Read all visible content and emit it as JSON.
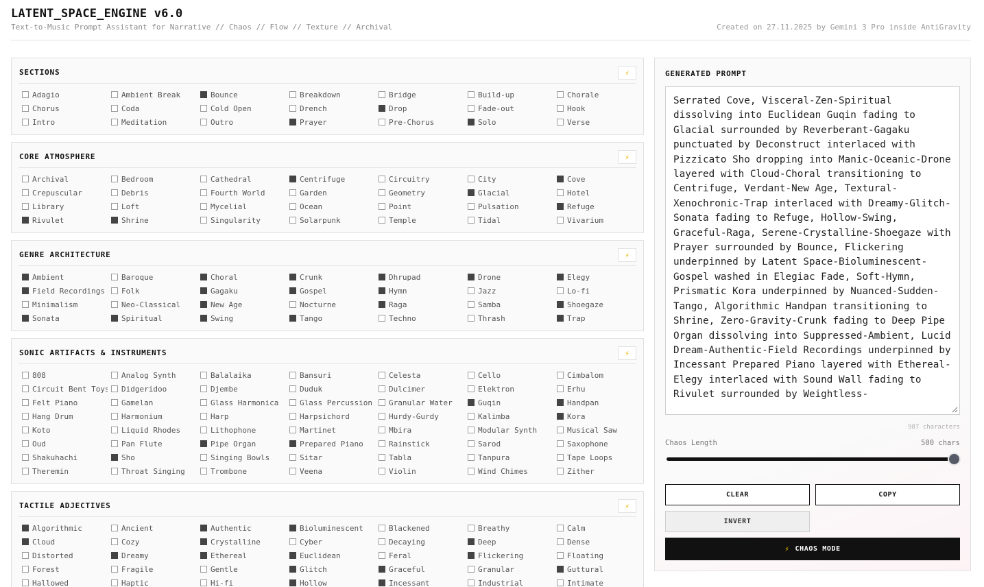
{
  "header": {
    "title": "LATENT_SPACE_ENGINE v6.0",
    "subtitle": "Text-to-Music Prompt Assistant for Narrative // Chaos // Flow // Texture // Archival",
    "credit": "Created on 27.11.2025 by Gemini 3 Pro inside AntiGravity"
  },
  "icons": {
    "randomize": "lightning-bolt-icon",
    "resize": "resize-grip-icon"
  },
  "colors": {
    "checked": "#444444",
    "accent_bolt": "#e6b800",
    "chaos_button": "#111111"
  },
  "sections": [
    {
      "title": "SECTIONS",
      "options": [
        {
          "label": "Adagio",
          "checked": false
        },
        {
          "label": "Ambient Break",
          "checked": false
        },
        {
          "label": "Bounce",
          "checked": true
        },
        {
          "label": "Breakdown",
          "checked": false
        },
        {
          "label": "Bridge",
          "checked": false
        },
        {
          "label": "Build-up",
          "checked": false
        },
        {
          "label": "Chorale",
          "checked": false
        },
        {
          "label": "Chorus",
          "checked": false
        },
        {
          "label": "Coda",
          "checked": false
        },
        {
          "label": "Cold Open",
          "checked": false
        },
        {
          "label": "Drench",
          "checked": false
        },
        {
          "label": "Drop",
          "checked": true
        },
        {
          "label": "Fade-out",
          "checked": false
        },
        {
          "label": "Hook",
          "checked": false
        },
        {
          "label": "Intro",
          "checked": false
        },
        {
          "label": "Meditation",
          "checked": false
        },
        {
          "label": "Outro",
          "checked": false
        },
        {
          "label": "Prayer",
          "checked": true
        },
        {
          "label": "Pre-Chorus",
          "checked": false
        },
        {
          "label": "Solo",
          "checked": true
        },
        {
          "label": "Verse",
          "checked": false
        }
      ]
    },
    {
      "title": "CORE ATMOSPHERE",
      "options": [
        {
          "label": "Archival",
          "checked": false
        },
        {
          "label": "Bedroom",
          "checked": false
        },
        {
          "label": "Cathedral",
          "checked": false
        },
        {
          "label": "Centrifuge",
          "checked": true
        },
        {
          "label": "Circuitry",
          "checked": false
        },
        {
          "label": "City",
          "checked": false
        },
        {
          "label": "Cove",
          "checked": true
        },
        {
          "label": "Crepuscular",
          "checked": false
        },
        {
          "label": "Debris",
          "checked": false
        },
        {
          "label": "Fourth World",
          "checked": false
        },
        {
          "label": "Garden",
          "checked": false
        },
        {
          "label": "Geometry",
          "checked": false
        },
        {
          "label": "Glacial",
          "checked": true
        },
        {
          "label": "Hotel",
          "checked": false
        },
        {
          "label": "Library",
          "checked": false
        },
        {
          "label": "Loft",
          "checked": false
        },
        {
          "label": "Mycelial",
          "checked": false
        },
        {
          "label": "Ocean",
          "checked": false
        },
        {
          "label": "Point",
          "checked": false
        },
        {
          "label": "Pulsation",
          "checked": false
        },
        {
          "label": "Refuge",
          "checked": true
        },
        {
          "label": "Rivulet",
          "checked": true
        },
        {
          "label": "Shrine",
          "checked": true
        },
        {
          "label": "Singularity",
          "checked": false
        },
        {
          "label": "Solarpunk",
          "checked": false
        },
        {
          "label": "Temple",
          "checked": false
        },
        {
          "label": "Tidal",
          "checked": false
        },
        {
          "label": "Vivarium",
          "checked": false
        }
      ]
    },
    {
      "title": "GENRE ARCHITECTURE",
      "options": [
        {
          "label": "Ambient",
          "checked": true
        },
        {
          "label": "Baroque",
          "checked": false
        },
        {
          "label": "Choral",
          "checked": true
        },
        {
          "label": "Crunk",
          "checked": true
        },
        {
          "label": "Dhrupad",
          "checked": true
        },
        {
          "label": "Drone",
          "checked": true
        },
        {
          "label": "Elegy",
          "checked": true
        },
        {
          "label": "Field Recordings",
          "checked": true
        },
        {
          "label": "Folk",
          "checked": false
        },
        {
          "label": "Gagaku",
          "checked": true
        },
        {
          "label": "Gospel",
          "checked": true
        },
        {
          "label": "Hymn",
          "checked": true
        },
        {
          "label": "Jazz",
          "checked": false
        },
        {
          "label": "Lo-fi",
          "checked": false
        },
        {
          "label": "Minimalism",
          "checked": false
        },
        {
          "label": "Neo-Classical",
          "checked": false
        },
        {
          "label": "New Age",
          "checked": true
        },
        {
          "label": "Nocturne",
          "checked": false
        },
        {
          "label": "Raga",
          "checked": true
        },
        {
          "label": "Samba",
          "checked": false
        },
        {
          "label": "Shoegaze",
          "checked": true
        },
        {
          "label": "Sonata",
          "checked": true
        },
        {
          "label": "Spiritual",
          "checked": true
        },
        {
          "label": "Swing",
          "checked": true
        },
        {
          "label": "Tango",
          "checked": true
        },
        {
          "label": "Techno",
          "checked": false
        },
        {
          "label": "Thrash",
          "checked": false
        },
        {
          "label": "Trap",
          "checked": true
        }
      ]
    },
    {
      "title": "SONIC ARTIFACTS & INSTRUMENTS",
      "options": [
        {
          "label": "808",
          "checked": false
        },
        {
          "label": "Analog Synth",
          "checked": false
        },
        {
          "label": "Balalaika",
          "checked": false
        },
        {
          "label": "Bansuri",
          "checked": false
        },
        {
          "label": "Celesta",
          "checked": false
        },
        {
          "label": "Cello",
          "checked": false
        },
        {
          "label": "Cimbalom",
          "checked": false
        },
        {
          "label": "Circuit Bent Toys",
          "checked": false
        },
        {
          "label": "Didgeridoo",
          "checked": false
        },
        {
          "label": "Djembe",
          "checked": false
        },
        {
          "label": "Duduk",
          "checked": false
        },
        {
          "label": "Dulcimer",
          "checked": false
        },
        {
          "label": "Elektron",
          "checked": false
        },
        {
          "label": "Erhu",
          "checked": false
        },
        {
          "label": "Felt Piano",
          "checked": false
        },
        {
          "label": "Gamelan",
          "checked": false
        },
        {
          "label": "Glass Harmonica",
          "checked": false
        },
        {
          "label": "Glass Percussion",
          "checked": false
        },
        {
          "label": "Granular Water",
          "checked": false
        },
        {
          "label": "Guqin",
          "checked": true
        },
        {
          "label": "Handpan",
          "checked": true
        },
        {
          "label": "Hang Drum",
          "checked": false
        },
        {
          "label": "Harmonium",
          "checked": false
        },
        {
          "label": "Harp",
          "checked": false
        },
        {
          "label": "Harpsichord",
          "checked": false
        },
        {
          "label": "Hurdy-Gurdy",
          "checked": false
        },
        {
          "label": "Kalimba",
          "checked": false
        },
        {
          "label": "Kora",
          "checked": true
        },
        {
          "label": "Koto",
          "checked": false
        },
        {
          "label": "Liquid Rhodes",
          "checked": false
        },
        {
          "label": "Lithophone",
          "checked": false
        },
        {
          "label": "Martinet",
          "checked": false
        },
        {
          "label": "Mbira",
          "checked": false
        },
        {
          "label": "Modular Synth",
          "checked": false
        },
        {
          "label": "Musical Saw",
          "checked": false
        },
        {
          "label": "Oud",
          "checked": false
        },
        {
          "label": "Pan Flute",
          "checked": false
        },
        {
          "label": "Pipe Organ",
          "checked": true
        },
        {
          "label": "Prepared Piano",
          "checked": true
        },
        {
          "label": "Rainstick",
          "checked": false
        },
        {
          "label": "Sarod",
          "checked": false
        },
        {
          "label": "Saxophone",
          "checked": false
        },
        {
          "label": "Shakuhachi",
          "checked": false
        },
        {
          "label": "Sho",
          "checked": true
        },
        {
          "label": "Singing Bowls",
          "checked": false
        },
        {
          "label": "Sitar",
          "checked": false
        },
        {
          "label": "Tabla",
          "checked": false
        },
        {
          "label": "Tanpura",
          "checked": false
        },
        {
          "label": "Tape Loops",
          "checked": false
        },
        {
          "label": "Theremin",
          "checked": false
        },
        {
          "label": "Throat Singing",
          "checked": false
        },
        {
          "label": "Trombone",
          "checked": false
        },
        {
          "label": "Veena",
          "checked": false
        },
        {
          "label": "Violin",
          "checked": false
        },
        {
          "label": "Wind Chimes",
          "checked": false
        },
        {
          "label": "Zither",
          "checked": false
        }
      ]
    },
    {
      "title": "TACTILE ADJECTIVES",
      "options": [
        {
          "label": "Algorithmic",
          "checked": true
        },
        {
          "label": "Ancient",
          "checked": false
        },
        {
          "label": "Authentic",
          "checked": true
        },
        {
          "label": "Bioluminescent",
          "checked": true
        },
        {
          "label": "Blackened",
          "checked": false
        },
        {
          "label": "Breathy",
          "checked": false
        },
        {
          "label": "Calm",
          "checked": false
        },
        {
          "label": "Cloud",
          "checked": true
        },
        {
          "label": "Cozy",
          "checked": false
        },
        {
          "label": "Crystalline",
          "checked": true
        },
        {
          "label": "Cyber",
          "checked": false
        },
        {
          "label": "Decaying",
          "checked": false
        },
        {
          "label": "Deep",
          "checked": true
        },
        {
          "label": "Dense",
          "checked": false
        },
        {
          "label": "Distorted",
          "checked": false
        },
        {
          "label": "Dreamy",
          "checked": true
        },
        {
          "label": "Ethereal",
          "checked": true
        },
        {
          "label": "Euclidean",
          "checked": true
        },
        {
          "label": "Feral",
          "checked": false
        },
        {
          "label": "Flickering",
          "checked": true
        },
        {
          "label": "Floating",
          "checked": false
        },
        {
          "label": "Forest",
          "checked": false
        },
        {
          "label": "Fragile",
          "checked": false
        },
        {
          "label": "Gentle",
          "checked": false
        },
        {
          "label": "Glitch",
          "checked": true
        },
        {
          "label": "Graceful",
          "checked": true
        },
        {
          "label": "Granular",
          "checked": false
        },
        {
          "label": "Guttural",
          "checked": true
        },
        {
          "label": "Hallowed",
          "checked": false
        },
        {
          "label": "Haptic",
          "checked": false
        },
        {
          "label": "Hi-fi",
          "checked": false
        },
        {
          "label": "Hollow",
          "checked": true
        },
        {
          "label": "Incessant",
          "checked": true
        },
        {
          "label": "Industrial",
          "checked": false
        },
        {
          "label": "Intimate",
          "checked": false
        }
      ]
    }
  ],
  "output": {
    "title": "GENERATED PROMPT",
    "prompt_text": "Serrated Cove, Visceral-Zen-Spiritual dissolving into Euclidean Guqin fading to Glacial surrounded by Reverberant-Gagaku punctuated by Deconstruct interlaced with Pizzicato Sho dropping into Manic-Oceanic-Drone layered with Cloud-Choral transitioning to Centrifuge, Verdant-New Age, Textural-Xenochronic-Trap interlaced with Dreamy-Glitch-Sonata fading to Refuge, Hollow-Swing, Graceful-Raga, Serene-Crystalline-Shoegaze with Prayer surrounded by Bounce, Flickering underpinned by Latent Space-Bioluminescent-Gospel washed in Elegiac Fade, Soft-Hymn, Prismatic Kora underpinned by Nuanced-Sudden-Tango, Algorithmic Handpan transitioning to Shrine, Zero-Gravity-Crunk fading to Deep Pipe Organ dissolving into Suppressed-Ambient, Lucid Dream-Authentic-Field Recordings underpinned by Incessant Prepared Piano layered with Ethereal-Elegy interlaced with Sound Wall fading to Rivulet surrounded by Weightless-",
    "char_count": "987 characters",
    "chaos_label": "Chaos Length",
    "chaos_value": "500 chars",
    "chaos_slider_fraction": 1.0,
    "buttons": {
      "clear": "CLEAR",
      "copy": "COPY",
      "invert": "INVERT",
      "chaos": "CHAOS MODE"
    }
  }
}
